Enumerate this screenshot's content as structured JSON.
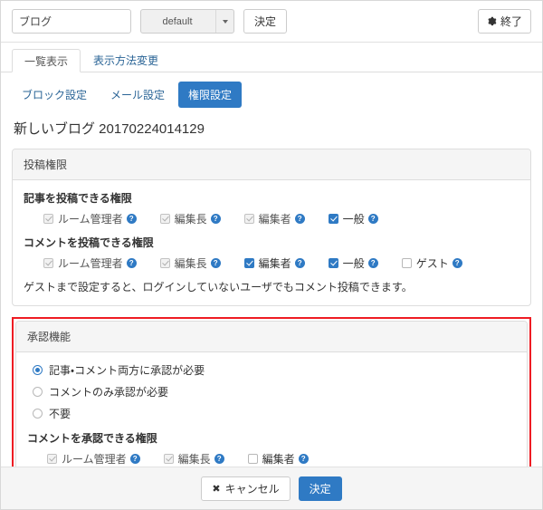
{
  "toolbar": {
    "name_value": "ブログ",
    "name_placeholder": "ブログ",
    "select_value": "default",
    "decide_label": "決定",
    "exit_label": "終了",
    "gear_icon": "gear-icon"
  },
  "tabs": [
    {
      "label": "一覧表示",
      "active": true
    },
    {
      "label": "表示方法変更",
      "active": false
    }
  ],
  "subtabs": [
    {
      "label": "ブロック設定",
      "active": false
    },
    {
      "label": "メール設定",
      "active": false
    },
    {
      "label": "権限設定",
      "active": true
    }
  ],
  "page_title": "新しいブログ 20170224014129",
  "help_icon_glyph": "?",
  "post_panel": {
    "heading": "投稿権限",
    "article_label": "記事を投稿できる権限",
    "article_options": [
      {
        "label": "ルーム管理者",
        "state": "checked-disabled"
      },
      {
        "label": "編集長",
        "state": "checked-disabled"
      },
      {
        "label": "編集者",
        "state": "checked-disabled"
      },
      {
        "label": "一般",
        "state": "checked-active"
      }
    ],
    "comment_label": "コメントを投稿できる権限",
    "comment_options": [
      {
        "label": "ルーム管理者",
        "state": "checked-disabled"
      },
      {
        "label": "編集長",
        "state": "checked-disabled"
      },
      {
        "label": "編集者",
        "state": "checked-active"
      },
      {
        "label": "一般",
        "state": "checked-active"
      },
      {
        "label": "ゲスト",
        "state": "unchecked"
      }
    ],
    "note": "ゲストまで設定すると、ログインしていないユーザでもコメント投稿できます。"
  },
  "approval_panel": {
    "heading": "承認機能",
    "highlight_color": "#ee1c23",
    "radios": [
      {
        "label": "記事・コメント両方に承認が必要",
        "selected": true
      },
      {
        "label": "コメントのみ承認が必要",
        "selected": false
      },
      {
        "label": "不要",
        "selected": false
      }
    ],
    "approver_label": "コメントを承認できる権限",
    "approver_options": [
      {
        "label": "ルーム管理者",
        "state": "checked-disabled"
      },
      {
        "label": "編集長",
        "state": "checked-disabled"
      },
      {
        "label": "編集者",
        "state": "unchecked"
      }
    ]
  },
  "footer": {
    "cancel_icon": "✖",
    "cancel_label": "キャンセル",
    "decide_label": "決定"
  }
}
